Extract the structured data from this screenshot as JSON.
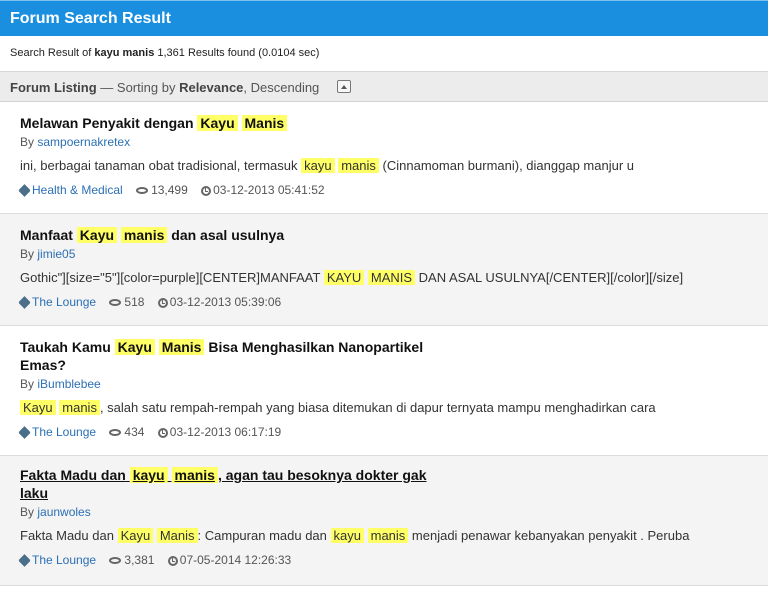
{
  "header": {
    "title": "Forum Search Result"
  },
  "summary": {
    "prefix": "Search Result of",
    "query": "kayu manis",
    "results": "1,361 Results found (0.0104 sec)"
  },
  "listing": {
    "label": "Forum Listing",
    "sort_prefix": "— Sorting by",
    "sort_field": "Relevance",
    "sort_order": ", Descending"
  },
  "results": [
    {
      "title_pre": "Melawan Penyakit dengan",
      "hl1": "Kayu",
      "hl2": "Manis",
      "title_post": "",
      "by_label": "By",
      "author": "sampoernakretex",
      "snippet_pre": "ini, berbagai tanaman obat tradisional, termasuk",
      "s_hl1": "kayu",
      "s_hl2": "manis",
      "snippet_mid": "(Cinnamoman burmani), dianggap manjur u",
      "category": "Health & Medical",
      "views": "13,499",
      "date": "03-12-2013 05:41:52"
    },
    {
      "title_pre": "Manfaat",
      "hl1": "Kayu",
      "hl2": "manis",
      "title_post": "dan asal usulnya",
      "by_label": "By",
      "author": "jimie05",
      "snippet_pre": "Gothic\"][size=\"5\"][color=purple][CENTER]MANFAAT",
      "s_hl1": "KAYU",
      "s_hl2": "MANIS",
      "snippet_mid": "DAN ASAL USULNYA[/CENTER][/color][/size]",
      "category": "The Lounge",
      "views": "518",
      "date": "03-12-2013 05:39:06"
    },
    {
      "title_pre": "Taukah Kamu",
      "hl1": "Kayu",
      "hl2": "Manis",
      "title_post": "Bisa Menghasilkan Nanopartikel Emas?",
      "by_label": "By",
      "author": "iBumblebee",
      "snippet_pre": "",
      "s_hl1": "Kayu",
      "s_hl2": "manis",
      "snippet_mid": ", salah satu rempah-rempah yang biasa ditemukan di dapur ternyata mampu menghadirkan cara",
      "category": "The Lounge",
      "views": "434",
      "date": "03-12-2013 06:17:19"
    },
    {
      "title_pre": "Fakta Madu dan",
      "hl1": "kayu",
      "hl2": "manis",
      "title_post": ", agan tau besoknya dokter gak laku",
      "by_label": "By",
      "author": "jaunwoles",
      "snippet_pre": "Fakta Madu dan",
      "s_hl1": "Kayu",
      "s_hl2": "Manis",
      "snippet_mid": ": Campuran madu dan",
      "s_hl3": "kayu",
      "s_hl4": "manis",
      "snippet_post": "menjadi penawar kebanyakan penyakit . Peruba",
      "category": "The Lounge",
      "views": "3,381",
      "date": "07-05-2014 12:26:33"
    }
  ]
}
